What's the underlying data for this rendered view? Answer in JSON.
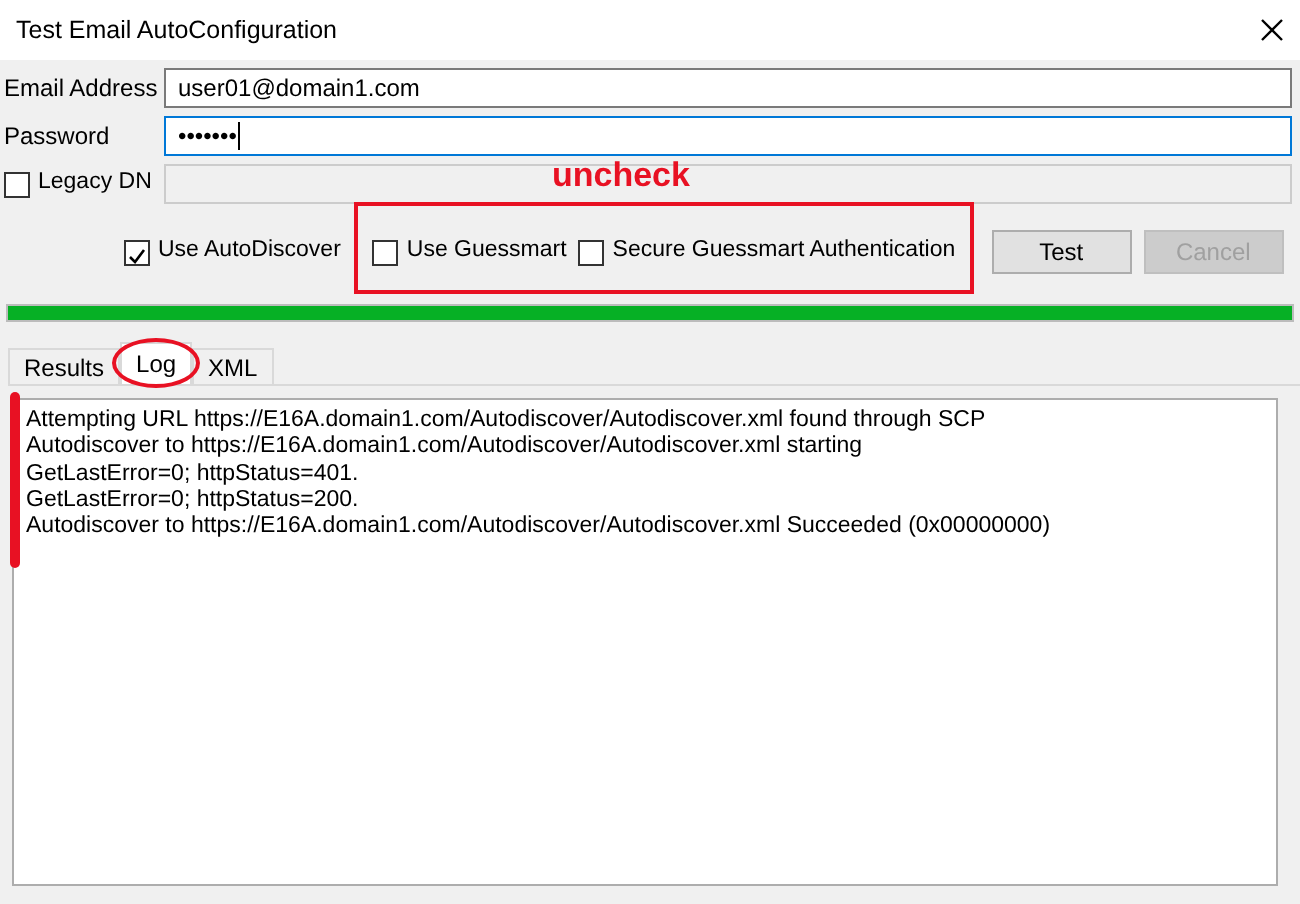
{
  "window": {
    "title": "Test Email AutoConfiguration"
  },
  "fields": [
    {
      "label": "Email Address",
      "value": "user01@domain1.com",
      "focused": false
    },
    {
      "label": "Password",
      "value": "•••••••",
      "focused": true
    }
  ],
  "legacy_dn": {
    "label": "Legacy DN",
    "checked": false
  },
  "options": [
    {
      "label": "Use AutoDiscover",
      "checked": true
    },
    {
      "label": "Use Guessmart",
      "checked": false
    },
    {
      "label": "Secure Guessmart Authentication",
      "checked": false
    }
  ],
  "buttons": [
    {
      "label": "Test",
      "disabled": false
    },
    {
      "label": "Cancel",
      "disabled": true
    }
  ],
  "progress": {
    "level": 1
  },
  "tabs": [
    {
      "label": "Results",
      "selected": false
    },
    {
      "label": "Log",
      "selected": true
    },
    {
      "label": "XML",
      "selected": false
    }
  ],
  "log_lines": [
    "Attempting URL https://E16A.domain1.com/Autodiscover/Autodiscover.xml found through SCP",
    "Autodiscover to https://E16A.domain1.com/Autodiscover/Autodiscover.xml starting",
    "GetLastError=0; httpStatus=401.",
    "GetLastError=0; httpStatus=200.",
    "Autodiscover to https://E16A.domain1.com/Autodiscover/Autodiscover.xml Succeeded (0x00000000)"
  ],
  "annotation": {
    "text": "uncheck"
  }
}
